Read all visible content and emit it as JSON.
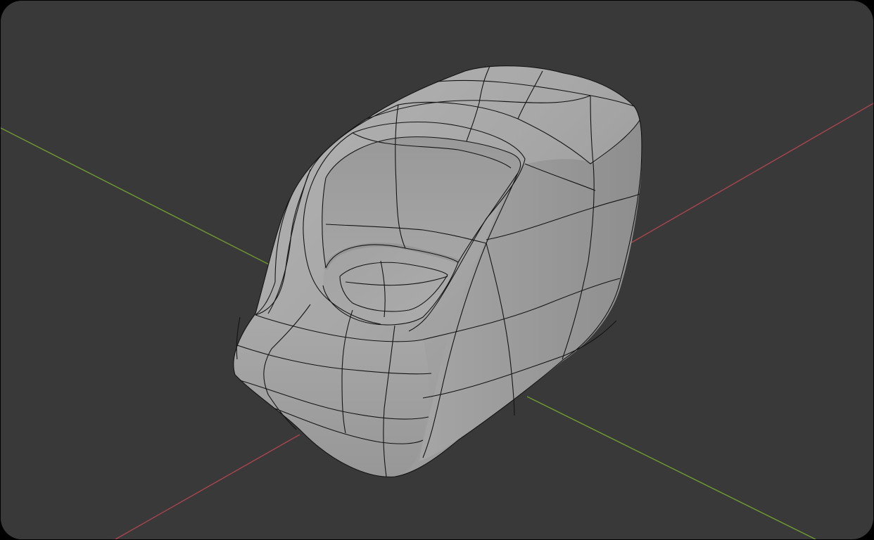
{
  "viewport": {
    "background_color": "#393939",
    "x_axis_color": "#a8454f",
    "y_axis_color": "#6f9a32",
    "mesh_base_color": "#a3a3a3",
    "wireframe_color": "#141414"
  },
  "scene": {
    "object": "armchair-mesh",
    "shading": "solid",
    "overlay": "wireframe"
  }
}
